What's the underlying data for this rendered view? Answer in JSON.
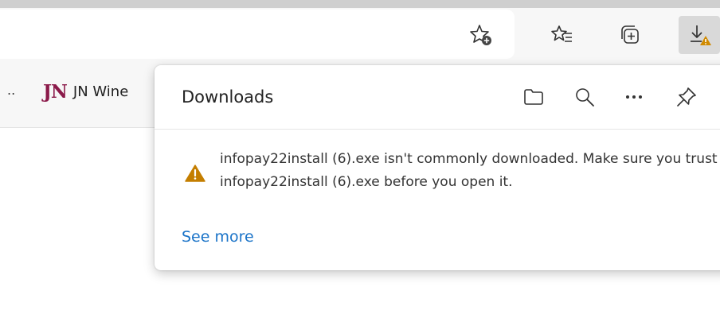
{
  "toolbar": {
    "buttons": [
      {
        "name": "add-favorite",
        "icon": "star-plus-icon"
      },
      {
        "name": "favorites",
        "icon": "favorites-list-icon"
      },
      {
        "name": "collections",
        "icon": "collections-icon"
      },
      {
        "name": "downloads",
        "icon": "download-warning-icon"
      }
    ]
  },
  "bookmarks": {
    "ellipsis": "..",
    "items": [
      {
        "logo": "JN",
        "label": "JN Wine"
      }
    ]
  },
  "downloads_panel": {
    "title": "Downloads",
    "header_icons": [
      "folder-icon",
      "search-icon",
      "more-icon",
      "pin-icon"
    ],
    "warning": {
      "icon": "warning-icon",
      "message": "infopay22install (6).exe isn't commonly downloaded. Make sure you trust infopay22install (6).exe before you open it."
    },
    "see_more_label": "See more"
  },
  "colors": {
    "accent": "#1a73c8",
    "warning": "#c47e00",
    "bookmark_logo": "#8b1a4a"
  }
}
